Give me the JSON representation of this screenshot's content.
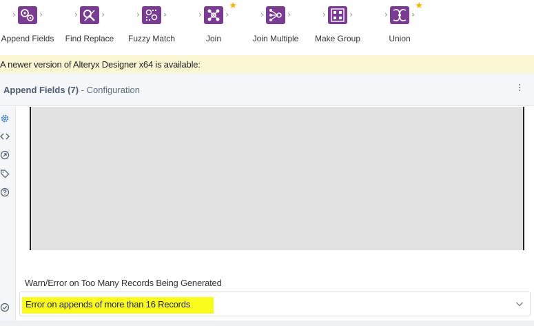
{
  "toolbar": {
    "tools": [
      {
        "label": "Append Fields",
        "icon": "append-fields-icon",
        "starred": false
      },
      {
        "label": "Find Replace",
        "icon": "find-replace-icon",
        "starred": false
      },
      {
        "label": "Fuzzy Match",
        "icon": "fuzzy-match-icon",
        "starred": false
      },
      {
        "label": "Join",
        "icon": "join-icon",
        "starred": true
      },
      {
        "label": "Join Multiple",
        "icon": "join-multiple-icon",
        "starred": false
      },
      {
        "label": "Make Group",
        "icon": "make-group-icon",
        "starred": false
      },
      {
        "label": "Union",
        "icon": "union-icon",
        "starred": true
      }
    ],
    "icon_color": "#7a3c92",
    "star_color": "#f4b400"
  },
  "notification": {
    "text": "A newer version of Alteryx Designer x64 is available:",
    "background": "#fbf7d4"
  },
  "config": {
    "tool_name": "Append Fields (7)",
    "separator": " - ",
    "section": "Configuration"
  },
  "side_rail": {
    "icons": [
      "gear-icon",
      "code-icon",
      "navigate-icon",
      "tag-icon",
      "help-icon"
    ],
    "bottom_icon": "check-circle-icon",
    "active_color": "#2f80d1"
  },
  "main": {
    "warn_label": "Warn/Error on Too Many Records Being Generated",
    "dropdown": {
      "selected": "Error on appends of more than 16 Records",
      "highlight_color": "#fafc1e"
    }
  }
}
